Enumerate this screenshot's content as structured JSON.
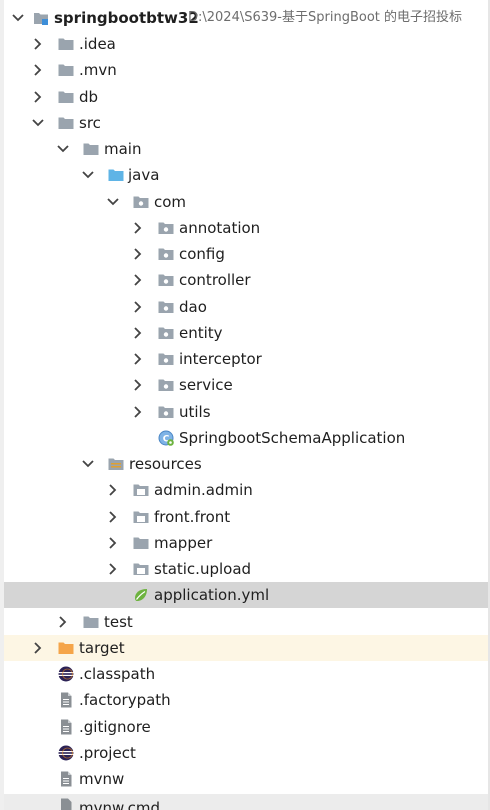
{
  "project": {
    "name": "springbootbtw32",
    "path": "D:\\2024\\S639-基于SpringBoot 的电子招投标"
  },
  "tree": {
    "idea": ".idea",
    "mvn": ".mvn",
    "db": "db",
    "src": "src",
    "main": "main",
    "java": "java",
    "com": "com",
    "annotation": "annotation",
    "config": "config",
    "controller": "controller",
    "dao": "dao",
    "entity": "entity",
    "interceptor": "interceptor",
    "service": "service",
    "utils": "utils",
    "app_class": "SpringbootSchemaApplication",
    "resources": "resources",
    "admin": "admin.admin",
    "front": "front.front",
    "mapper": "mapper",
    "static": "static.upload",
    "yml": "application.yml",
    "test": "test",
    "target": "target",
    "classpath": ".classpath",
    "factorypath": ".factorypath",
    "gitignore": ".gitignore",
    "project_file": ".project",
    "mvnw": "mvnw",
    "mvnw_cmd": "mvnw.cmd"
  },
  "colors": {
    "selected_row": "#d5d5d5",
    "excluded_row": "#fdf6e4",
    "folder_gray": "#9aa4ae",
    "source_folder": "#5fb4e6",
    "excluded_folder": "#f5a54a",
    "spring_green": "#6db33f",
    "eclipse_navy": "#2c2255"
  },
  "icons": {
    "chevron_right": "chevron-right-icon",
    "chevron_down": "chevron-down-icon",
    "folder": "folder-icon",
    "package": "package-icon",
    "resources": "resources-folder-icon",
    "module": "module-icon",
    "spring_boot_class": "spring-boot-class-icon",
    "yaml": "spring-yaml-icon",
    "eclipse": "eclipse-file-icon",
    "text_file": "text-file-icon"
  }
}
